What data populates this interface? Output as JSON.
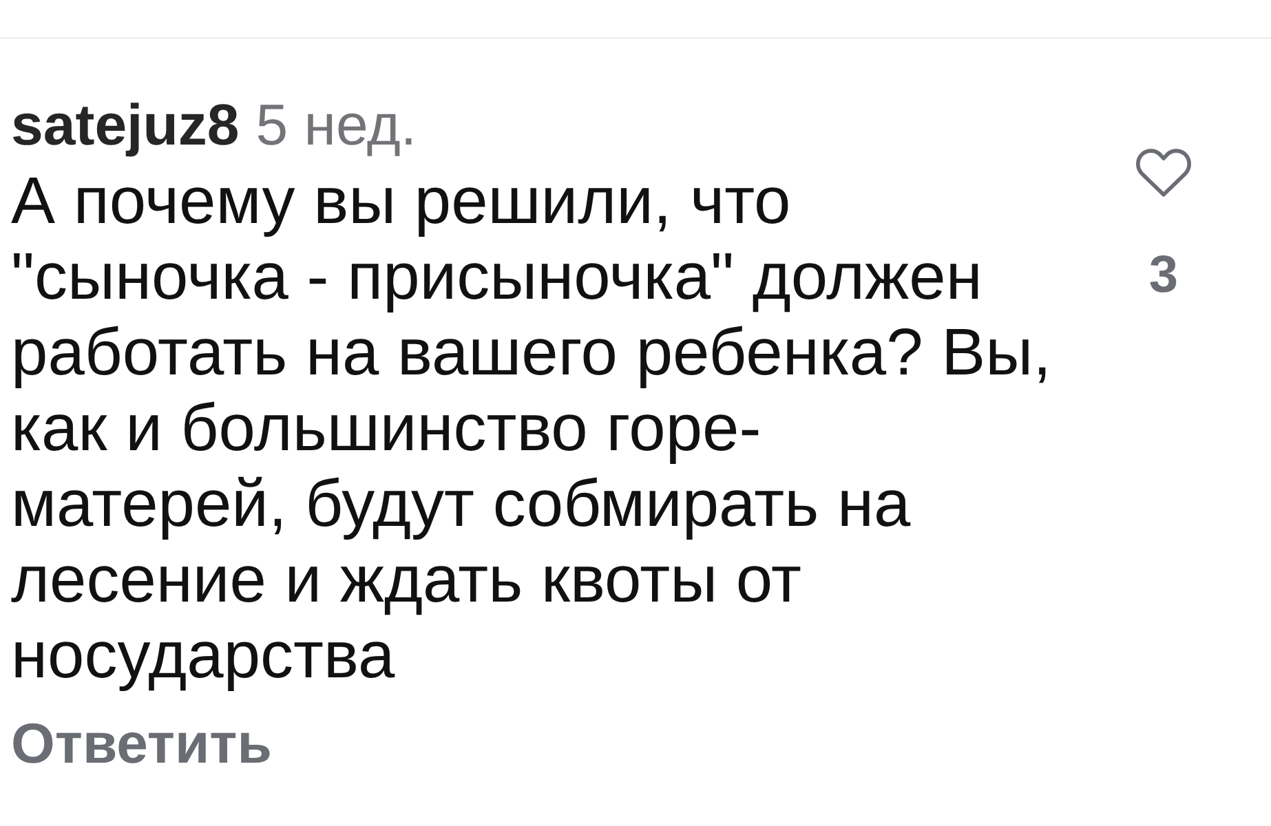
{
  "comment": {
    "username": "satejuz8",
    "time": "5 нед.",
    "text_lines": [
      "А почему вы решили, что",
      "\"сыночка - присыночка\" должен",
      "работать на вашего ребенка? Вы,",
      "как и большинство горе-",
      "матерей, будут собмирать на",
      "лесение и ждать квоты от",
      "носударства"
    ],
    "liked": false,
    "like_count": "3"
  },
  "reply_button": "Ответить"
}
